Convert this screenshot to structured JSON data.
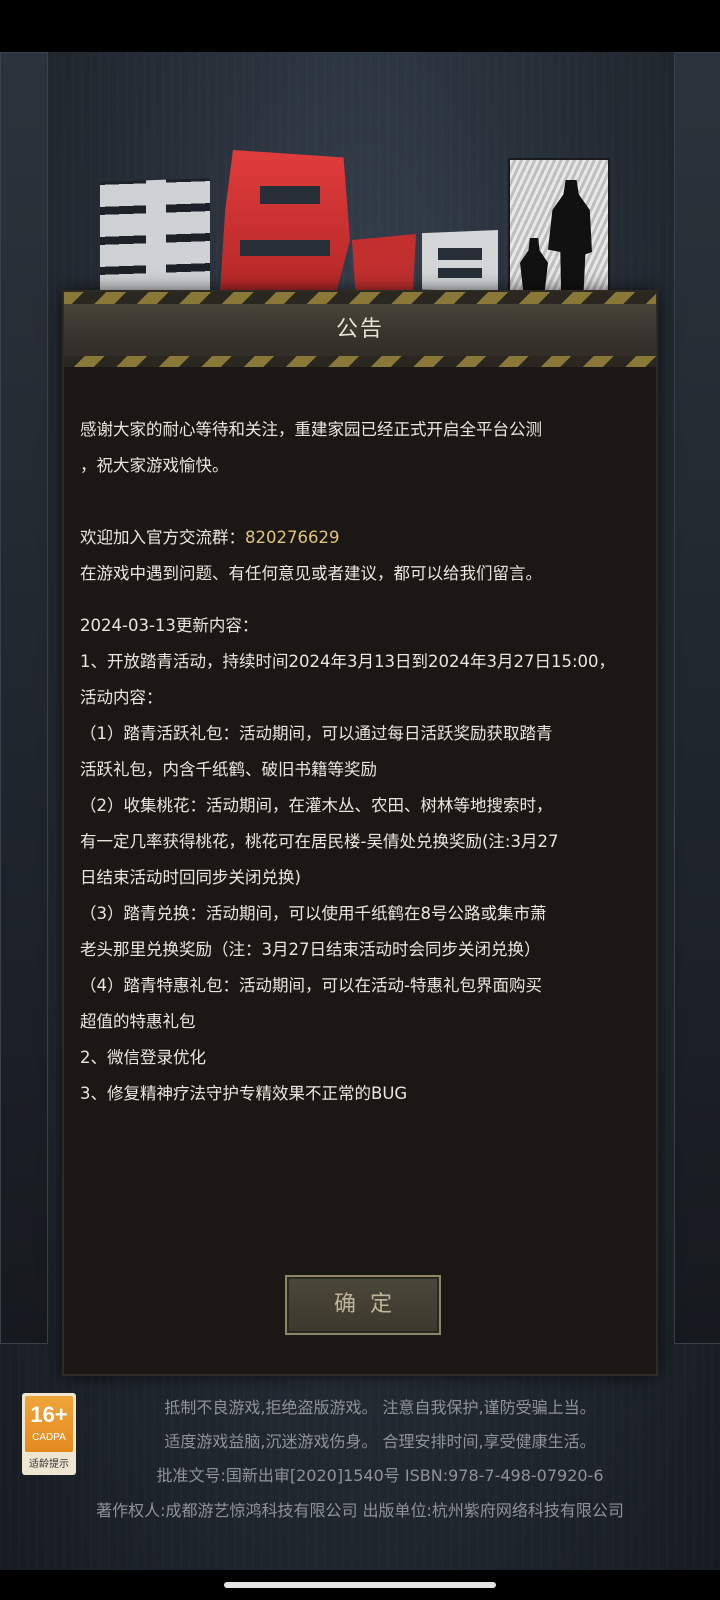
{
  "logo": {
    "text": "重建家园"
  },
  "dialog": {
    "title": "公告",
    "intro_line1": "感谢大家的耐心等待和关注，重建家园已经正式开启全平台公测",
    "intro_line2": "，祝大家游戏愉快。",
    "group_label": "欢迎加入官方交流群：",
    "group_number": "820276629",
    "feedback": "在游戏中遇到问题、有任何意见或者建议，都可以给我们留言。",
    "update_header": "2024-03-13更新内容：",
    "lines": [
      "1、开放踏青活动，持续时间2024年3月13日到2024年3月27日15:00，",
      "活动内容：",
      "（1）踏青活跃礼包：活动期间，可以通过每日活跃奖励获取踏青",
      "活跃礼包，内含千纸鹤、破旧书籍等奖励",
      "（2）收集桃花：活动期间，在灌木丛、农田、树林等地搜索时，",
      "有一定几率获得桃花，桃花可在居民楼-吴倩处兑换奖励(注:3月27",
      "日结束活动时回同步关闭兑换)",
      "（3）踏青兑换：活动期间，可以使用千纸鹤在8号公路或集市萧",
      "老头那里兑换奖励（注：3月27日结束活动时会同步关闭兑换）",
      "（4）踏青特惠礼包：活动期间，可以在活动-特惠礼包界面购买",
      "超值的特惠礼包",
      "2、微信登录优化",
      "3、修复精神疗法守护专精效果不正常的BUG"
    ],
    "confirm_label": "确定"
  },
  "rating": {
    "age": "16+",
    "org": "CADPA",
    "tip": "适龄提示"
  },
  "footer": {
    "line1": "抵制不良游戏,拒绝盗版游戏。 注意自我保护,谨防受骗上当。",
    "line2": "适度游戏益脑,沉迷游戏伤身。 合理安排时间,享受健康生活。",
    "line3": "批准文号:国新出审[2020]1540号   ISBN:978-7-498-07920-6",
    "line4": "著作权人:成都游艺惊鸿科技有限公司 出版单位:杭州紫府网络科技有限公司"
  },
  "colors": {
    "accent_gold": "#e0c27a",
    "logo_red": "#d83a3a",
    "panel_bg": "#1a1714"
  }
}
